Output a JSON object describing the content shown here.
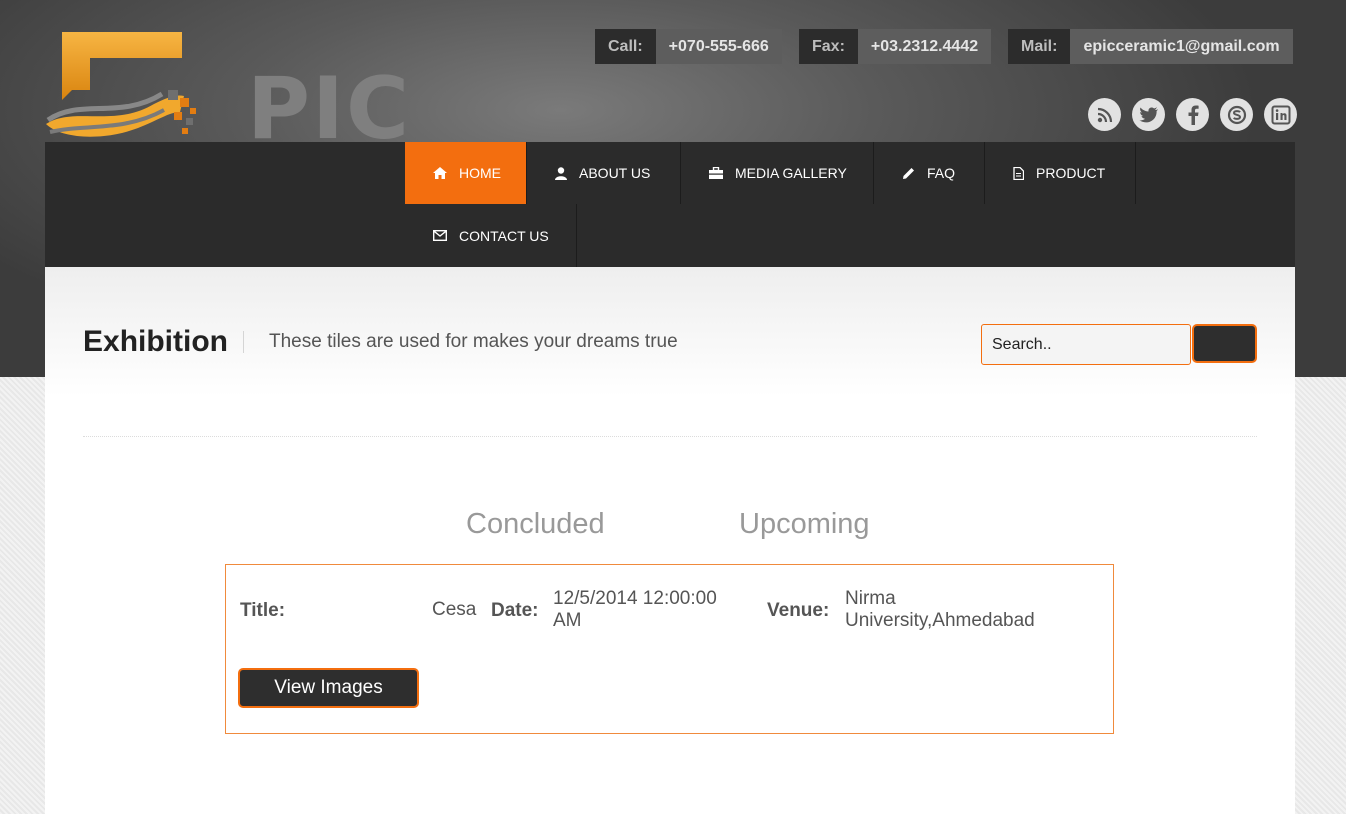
{
  "brand": {
    "logo_text": "PIC"
  },
  "contacts": [
    {
      "label": "Call:",
      "value": "+070-555-666"
    },
    {
      "label": "Fax:",
      "value": "+03.2312.4442"
    },
    {
      "label": "Mail:",
      "value": "epicceramic1@gmail.com"
    }
  ],
  "social": [
    "rss-icon",
    "twitter-icon",
    "facebook-icon",
    "skype-icon",
    "linkedin-icon"
  ],
  "nav": {
    "items": [
      {
        "label": "HOME",
        "icon": "home-icon",
        "active": true
      },
      {
        "label": "ABOUT US",
        "icon": "user-icon"
      },
      {
        "label": "MEDIA GALLERY",
        "icon": "briefcase-icon"
      },
      {
        "label": "FAQ",
        "icon": "pencil-icon"
      },
      {
        "label": "PRODUCT",
        "icon": "document-icon"
      },
      {
        "label": "CONTACT US",
        "icon": "envelope-icon"
      }
    ]
  },
  "page": {
    "title": "Exhibition",
    "subtitle": "These tiles are used for makes your dreams true"
  },
  "search": {
    "placeholder": "Search.."
  },
  "tabs": [
    "Concluded",
    "Upcoming"
  ],
  "exhibition": {
    "title_label": "Title:",
    "title_value": "Cesa",
    "date_label": "Date:",
    "date_value": "12/5/2014 12:00:00 AM",
    "venue_label": "Venue:",
    "venue_value": "Nirma University,Ahmedabad",
    "view_button": "View Images"
  },
  "colors": {
    "accent": "#f36e0f",
    "nav_bg": "#2b2b2b",
    "header_bg": "#5a5a5a"
  }
}
